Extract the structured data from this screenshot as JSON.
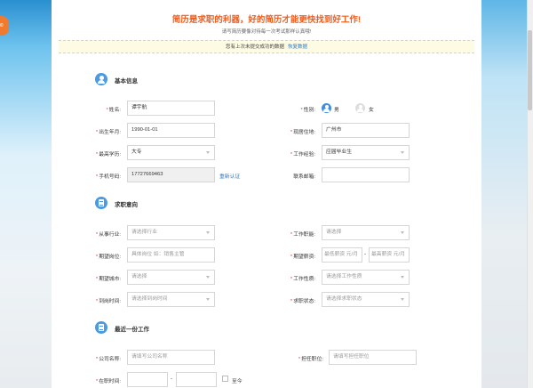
{
  "header": {
    "badge": "00",
    "title": "简历是求职的利器，好的简历才能更快找到好工作!",
    "subtitle": "请写简历要像对待每一次考试那样认真哦!",
    "notice_text": "您有上次未提交成功的数据",
    "notice_link": "恢复数据"
  },
  "basic": {
    "section_title": "基本信息",
    "name_label": "姓名:",
    "name_value": "谭宇航",
    "gender_label": "性别:",
    "gender_male": "男",
    "gender_female": "女",
    "birth_label": "出生年月:",
    "birth_value": "1990-01-01",
    "residence_label": "现居住地:",
    "residence_value": "广州市",
    "education_label": "最高学历:",
    "education_value": "大专",
    "experience_label": "工作经验:",
    "experience_value": "应届毕业生",
    "phone_label": "手机号码:",
    "phone_value": "17727669463",
    "reverify_link": "重新认证",
    "email_label": "联系邮箱:",
    "email_value": ""
  },
  "intent": {
    "section_title": "求职意向",
    "industry_label": "从事行业:",
    "industry_placeholder": "请选择行业",
    "function_label": "工作职能:",
    "function_placeholder": "请选择",
    "position_label": "期望岗位:",
    "position_placeholder": "具体岗位 如：销售主管",
    "salary_label": "期望薪资:",
    "salary_min_placeholder": "最低薪资 元/月",
    "salary_max_placeholder": "最高薪资 元/月",
    "salary_dash": "-",
    "city_label": "期望城市:",
    "city_placeholder": "请选择",
    "nature_label": "工作性质:",
    "nature_placeholder": "请选择工作性质",
    "arrival_label": "到岗时间:",
    "arrival_placeholder": "请选择到岗时间",
    "status_label": "求职状态:",
    "status_placeholder": "请选择求职状态"
  },
  "work": {
    "section_title": "最近一份工作",
    "company_label": "公司名称:",
    "company_placeholder": "请填写公司名称",
    "job_label": "担任职位:",
    "job_placeholder": "请填写担任职位",
    "period_label": "在职时间:",
    "period_dash": "-",
    "present_label": "至今"
  },
  "colors": {
    "title_orange": "#f25c1b",
    "required_red": "#e53d3d",
    "link_blue": "#2b78c5",
    "icon_blue": "#4a9be3"
  }
}
